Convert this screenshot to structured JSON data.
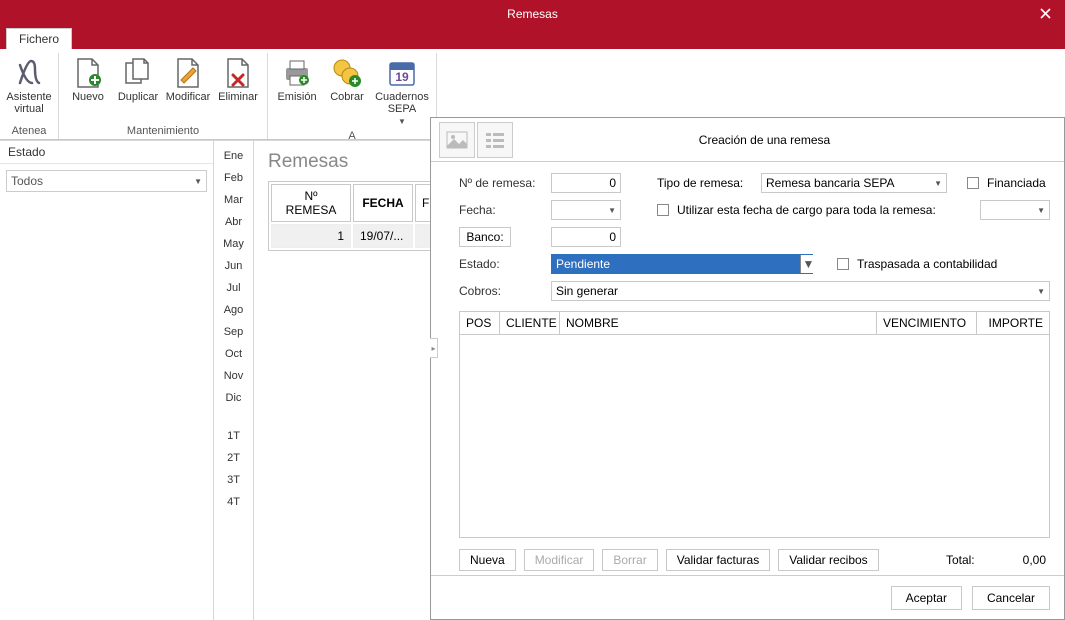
{
  "window": {
    "title": "Remesas"
  },
  "tabs": {
    "file": "Fichero"
  },
  "ribbon": {
    "groups": {
      "atenea": {
        "label": "Atenea",
        "assistant": "Asistente\nvirtual"
      },
      "mant": {
        "label": "Mantenimiento",
        "nuevo": "Nuevo",
        "dup": "Duplicar",
        "mod": "Modificar",
        "del": "Eliminar"
      },
      "acc": {
        "label": "A",
        "emi": "Emisión",
        "cobr": "Cobrar",
        "sepa": "Cuadernos\nSEPA"
      }
    }
  },
  "sidebar": {
    "estado_label": "Estado",
    "filter_value": "Todos"
  },
  "months": [
    "Ene",
    "Feb",
    "Mar",
    "Abr",
    "May",
    "Jun",
    "Jul",
    "Ago",
    "Sep",
    "Oct",
    "Nov",
    "Dic"
  ],
  "quarters": [
    "1T",
    "2T",
    "3T",
    "4T"
  ],
  "content": {
    "title": "Remesas",
    "columns": {
      "num": "Nº REMESA",
      "fecha": "FECHA",
      "fecfin": "FECI"
    },
    "row1": {
      "num": "1",
      "fecha": "19/07/..."
    }
  },
  "dialog": {
    "title": "Creación de una remesa",
    "num_label": "Nº de remesa:",
    "num_value": "0",
    "tipo_label": "Tipo de remesa:",
    "tipo_value": "Remesa bancaria SEPA",
    "fin_label": "Financiada",
    "fecha_label": "Fecha:",
    "fecha_value": "",
    "cargo_label": "Utilizar esta fecha de cargo para toda la remesa:",
    "banco_btn": "Banco:",
    "banco_value": "0",
    "estado_label": "Estado:",
    "estado_value": "Pendiente",
    "trasp_label": "Traspasada a contabilidad",
    "cobros_label": "Cobros:",
    "cobros_value": "Sin generar",
    "grid_cols": {
      "pos": "POS",
      "cli": "CLIENTE",
      "nom": "NOMBRE",
      "venc": "VENCIMIENTO",
      "imp": "IMPORTE"
    },
    "actions": {
      "nueva": "Nueva",
      "mod": "Modificar",
      "borrar": "Borrar",
      "valfac": "Validar facturas",
      "valrec": "Validar recibos"
    },
    "total_label": "Total:",
    "total_value": "0,00",
    "accept": "Aceptar",
    "cancel": "Cancelar"
  }
}
